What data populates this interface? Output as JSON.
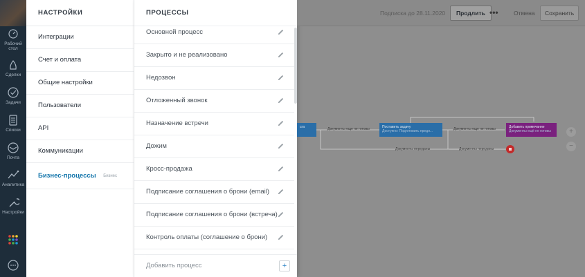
{
  "rail": {
    "items": [
      {
        "label": "Рабочий стол",
        "icon": "dashboard-icon"
      },
      {
        "label": "Сделки",
        "icon": "deals-icon"
      },
      {
        "label": "Задачи",
        "icon": "tasks-icon"
      },
      {
        "label": "Списки",
        "icon": "lists-icon"
      },
      {
        "label": "Почта",
        "icon": "mail-icon"
      },
      {
        "label": "Аналитика",
        "icon": "analytics-icon"
      },
      {
        "label": "Настройки",
        "icon": "settings-icon"
      }
    ]
  },
  "settings": {
    "title": "НАСТРОЙКИ",
    "items": [
      {
        "label": "Интеграции"
      },
      {
        "label": "Счет и оплата"
      },
      {
        "label": "Общие настройки"
      },
      {
        "label": "Пользователи"
      },
      {
        "label": "API"
      },
      {
        "label": "Коммуникации"
      },
      {
        "label": "Бизнес-процессы",
        "badge": "Бизнес"
      }
    ]
  },
  "processes": {
    "title": "ПРОЦЕССЫ",
    "items": [
      {
        "label": "Основной процесс"
      },
      {
        "label": "Закрыто и не реализовано"
      },
      {
        "label": "Недозвон"
      },
      {
        "label": "Отложенный звонок"
      },
      {
        "label": "Назначение встречи"
      },
      {
        "label": "Дожим"
      },
      {
        "label": "Кросс-продажа"
      },
      {
        "label": "Подписание соглашения о брони (email)"
      },
      {
        "label": "Подписание соглашения о брони (встреча)"
      },
      {
        "label": "Контроль оплаты (соглашение о брони)"
      }
    ],
    "add_label": "Добавить процесс"
  },
  "topbar": {
    "subscription": "Подписка до 28.11.2020",
    "renew": "Продлить",
    "more": "•••",
    "cancel": "Отмена",
    "save": "Сохранить"
  },
  "flow": {
    "node1": {
      "title": "Поставить задачу",
      "sub": "Доступно: Подготовить предл..."
    },
    "node2": {
      "title": "Добавить примечание",
      "sub": "Документы ещё не готовы"
    },
    "edge1": "Документы еще не готовы",
    "edge2": "Документы еще не готовы",
    "edge3": "Документы переданы",
    "edge4": "Документы переданы",
    "node0_label": "сга"
  },
  "colors": {
    "accent": "#1375ab",
    "node_blue": "#2a6ea8",
    "node_purple": "#7a217e",
    "stop_red": "#c32a2a"
  }
}
